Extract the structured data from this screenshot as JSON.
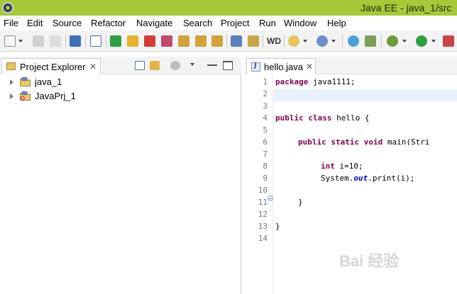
{
  "window": {
    "title": "Java EE - java_1/src"
  },
  "menu": [
    "File",
    "Edit",
    "Source",
    "Refactor",
    "Navigate",
    "Search",
    "Project",
    "Run",
    "Window",
    "Help"
  ],
  "toolbar": {
    "wd_label": "WD"
  },
  "project_explorer": {
    "tab_label": "Project Explorer",
    "close_glyph": "✕",
    "items": [
      {
        "label": "java_1",
        "icon": "java-project-folder-icon"
      },
      {
        "label": "JavaPrj_1",
        "icon": "java-project-error-icon"
      }
    ]
  },
  "editor": {
    "tab_label": "hello.java",
    "close_glyph": "✕",
    "line_numbers": [
      "1",
      "2",
      "3",
      "4",
      "5",
      "6",
      "7",
      "8",
      "9",
      "10",
      "11",
      "12",
      "13",
      "14"
    ],
    "code": {
      "l1_kw": "package",
      "l1_rest": " java1111;",
      "l4_kw1": "public",
      "l4_kw2": "class",
      "l4_rest": " hello {",
      "l6_kw1": "public",
      "l6_kw2": "static",
      "l6_kw3": "void",
      "l6_rest": " main(Stri",
      "l8_kw": "int",
      "l8_rest": " i=10;",
      "l9_a": "System.",
      "l9_fld": "out",
      "l9_b": ".print(i);",
      "l11": "}",
      "l13": "}"
    }
  },
  "watermark": {
    "text": "Bai 经验"
  },
  "colors": {
    "title_bar": "#a6c93a",
    "keyword": "#7f0055",
    "field": "#0000c0",
    "current_line": "#e8f2fe"
  }
}
